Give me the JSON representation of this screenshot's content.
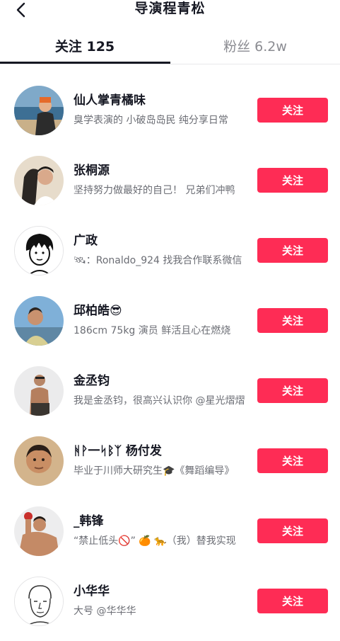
{
  "header": {
    "title": "导演程青松",
    "back_icon": "chevron-left-icon"
  },
  "tabs": [
    {
      "label": "关注 125",
      "active": true
    },
    {
      "label": "粉丝 6.2w",
      "active": false
    }
  ],
  "colors": {
    "accent": "#fe2c55",
    "text": "#161823",
    "muted": "#8a8b91"
  },
  "users": [
    {
      "name": "仙人掌青橘味",
      "bio": "臭学表演的 小破岛岛民 纯分享日常",
      "button": "关注",
      "avatar": "photo-avatar"
    },
    {
      "name": "张桐源",
      "bio": "坚持努力做最好的自己！ 兄弟们冲鸭",
      "button": "关注",
      "avatar": "photo-avatar"
    },
    {
      "name": "广政",
      "bio": "🛰：Ronaldo_924 找我合作联系微信",
      "button": "关注",
      "avatar": "illustrated-avatar"
    },
    {
      "name": "邱柏皓😎",
      "bio": "186cm 75kg 演员  鲜活且心在燃烧",
      "button": "关注",
      "avatar": "photo-avatar"
    },
    {
      "name": "金丞钧",
      "bio": "我是金丞钧，很高兴认识你 @星光熠熠",
      "button": "关注",
      "avatar": "photo-avatar"
    },
    {
      "name": "ᚻᚹ一ᛋᛒᛉ 杨付发",
      "bio": "毕业于川师大研究生🎓《舞蹈编导》",
      "button": "关注",
      "avatar": "photo-avatar"
    },
    {
      "name": "_韩锋",
      "bio": "“禁止低头🚫” 🍊 🐆（我）替我实现",
      "button": "关注",
      "avatar": "photo-avatar"
    },
    {
      "name": "小华华",
      "bio": "大号 @华华华",
      "button": "关注",
      "avatar": "sketch-avatar"
    }
  ]
}
